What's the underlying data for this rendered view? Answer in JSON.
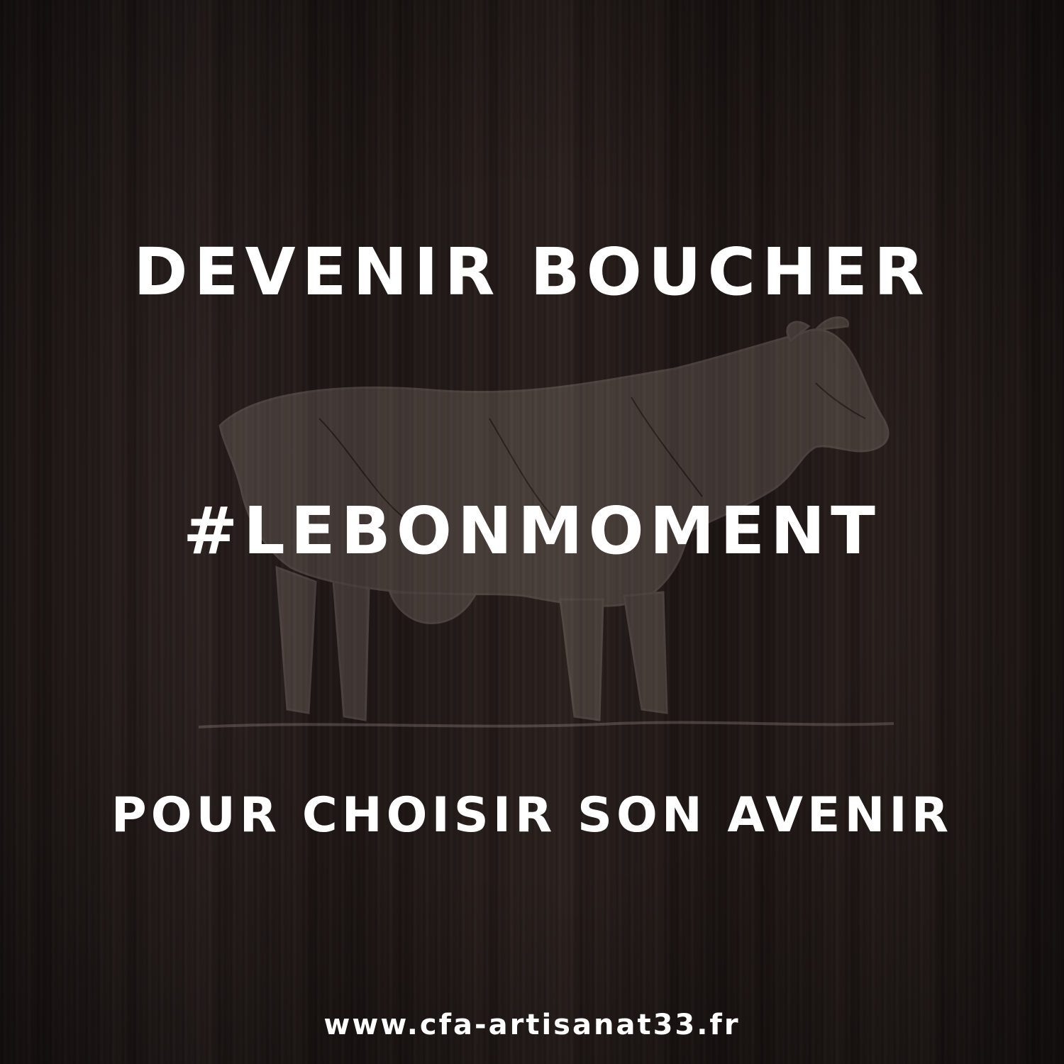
{
  "poster": {
    "headline": "DEVENIR BOUCHER",
    "hashtag": "#LEBONMOMENT",
    "subline": "POUR CHOISIR SON AVENIR",
    "website": "www.cfa-artisanat33.fr",
    "background": "dark-wood-texture",
    "illustration": "cow-sketch",
    "colors": {
      "text": "#ffffff",
      "background": "#221a18"
    }
  }
}
